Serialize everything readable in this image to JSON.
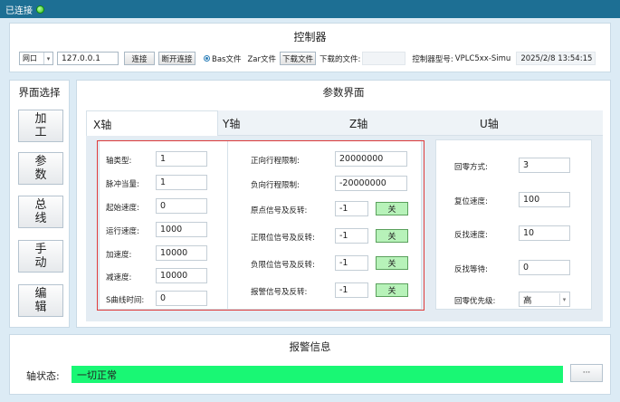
{
  "titlebar": {
    "status": "已连接",
    "indicator_color": "#2bbf1e"
  },
  "controller": {
    "title": "控制器",
    "port_type": "网口",
    "ip": "127.0.0.1",
    "connect_label": "连接",
    "disconnect_label": "断开连接",
    "radio_bas": "Bas文件",
    "radio_zar": "Zar文件",
    "download_label": "下载文件",
    "downloaded_label": "下载的文件:",
    "downloaded_value": "",
    "model_label": "控制器型号:",
    "model_value": "VPLC5xx-Simu",
    "datetime": "2025/2/8 13:54:15"
  },
  "sidebar": {
    "title": "界面选择",
    "items": [
      {
        "line1": "加",
        "line2": "工"
      },
      {
        "line1": "参",
        "line2": "数"
      },
      {
        "line1": "总",
        "line2": "线"
      },
      {
        "line1": "手",
        "line2": "动"
      },
      {
        "line1": "编",
        "line2": "辑"
      }
    ]
  },
  "params": {
    "title": "参数界面",
    "tabs": [
      "X轴",
      "Y轴",
      "Z轴",
      "U轴"
    ],
    "active_tab": "X轴",
    "left": [
      {
        "label": "轴类型:",
        "value": "1"
      },
      {
        "label": "脉冲当量:",
        "value": "1"
      },
      {
        "label": "起始速度:",
        "value": "0"
      },
      {
        "label": "运行速度:",
        "value": "1000"
      },
      {
        "label": "加速度:",
        "value": "10000"
      },
      {
        "label": "减速度:",
        "value": "10000"
      },
      {
        "label": "S曲线时间:",
        "value": "0"
      }
    ],
    "middle": [
      {
        "label": "正向行程限制:",
        "value": "20000000"
      },
      {
        "label": "负向行程限制:",
        "value": "-20000000"
      },
      {
        "label": "原点信号及反转:",
        "value": "-1",
        "toggle": "关"
      },
      {
        "label": "正限位信号及反转:",
        "value": "-1",
        "toggle": "关"
      },
      {
        "label": "负限位信号及反转:",
        "value": "-1",
        "toggle": "关"
      },
      {
        "label": "报警信号及反转:",
        "value": "-1",
        "toggle": "关"
      }
    ],
    "right": [
      {
        "label": "回零方式:",
        "value": "3"
      },
      {
        "label": "复位速度:",
        "value": "100"
      },
      {
        "label": "反找速度:",
        "value": "10"
      },
      {
        "label": "反找等待:",
        "value": "0"
      },
      {
        "label": "回零优先级:",
        "value": "高"
      }
    ]
  },
  "alarm": {
    "title": "报警信息",
    "status_label": "轴状态:",
    "status_value": "一切正常",
    "status_color": "#19f774",
    "more_label": "···"
  }
}
